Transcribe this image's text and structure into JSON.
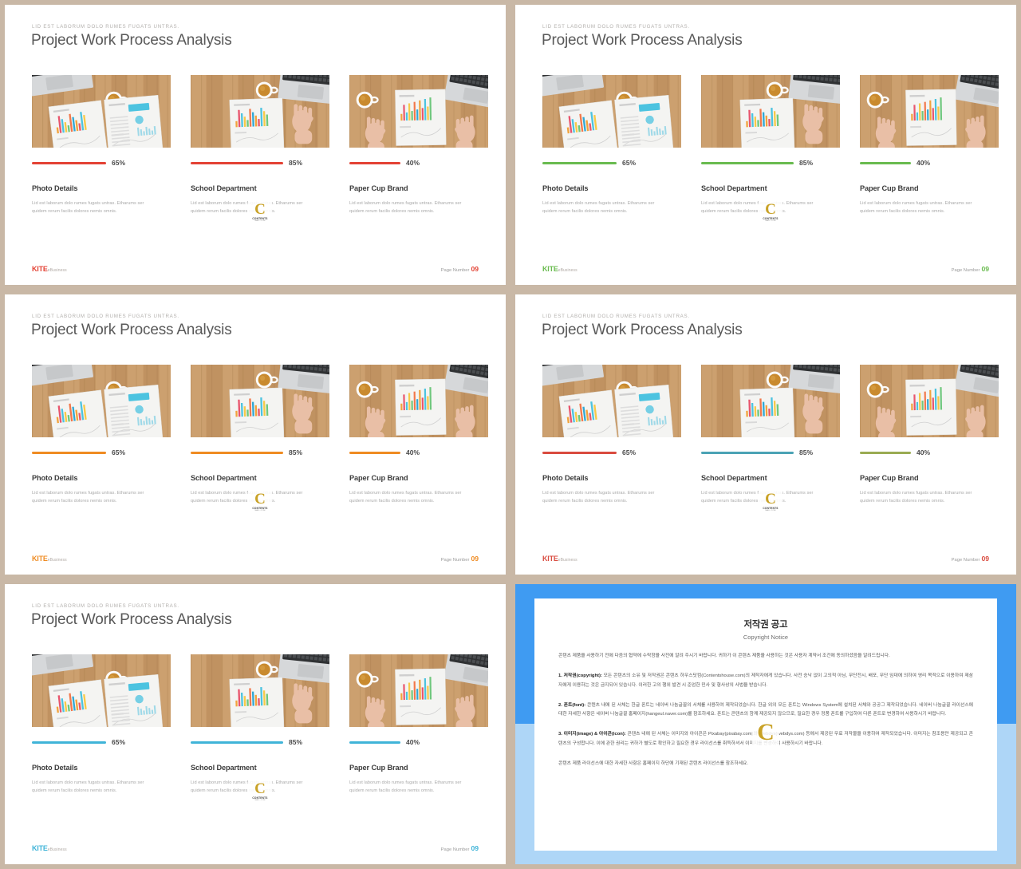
{
  "slide": {
    "eyebrow": "LID EST LABORUM  DOLO RUMES FUGATS  UNTRAS.",
    "title": "Project Work Process Analysis",
    "footer": {
      "brand_main": "KITE",
      "brand_sub": "eBusiness",
      "page_label": "Page Number",
      "page_number": "09"
    },
    "cards": [
      {
        "title": "Photo Details",
        "body": "Lid est laborum dolo rumes fugats untras. Etharums ser quidem rerum facilis dolores nemis omnis.",
        "percent_label": "65%",
        "percent_value": 65
      },
      {
        "title": "School Department",
        "body": "Lid est laborum dolo rumes fugats untras. Etharums ser quidem rerum facilis dolores nemis omnis.",
        "percent_label": "85%",
        "percent_value": 85
      },
      {
        "title": "Paper Cup Brand",
        "body": "Lid est laborum dolo rumes fugats untras. Etharums ser quidem rerum facilis dolores nemis omnis.",
        "percent_label": "40%",
        "percent_value": 40
      }
    ]
  },
  "variants": [
    {
      "name": "red",
      "accent": "#e34234",
      "bar_colors": [
        "#e34234",
        "#e34234",
        "#e34234"
      ],
      "brand_color": "#e34234",
      "page_color": "#e34234"
    },
    {
      "name": "green",
      "accent": "#69bb4f",
      "bar_colors": [
        "#69bb4f",
        "#69bb4f",
        "#69bb4f"
      ],
      "brand_color": "#69bb4f",
      "page_color": "#69bb4f"
    },
    {
      "name": "orange",
      "accent": "#ef8b22",
      "bar_colors": [
        "#ef8b22",
        "#ef8b22",
        "#ef8b22"
      ],
      "brand_color": "#ef8b22",
      "page_color": "#ef8b22"
    },
    {
      "name": "multicolor",
      "accent": "#d94b3f",
      "bar_colors": [
        "#d94b3f",
        "#4ba3b5",
        "#9aab52"
      ],
      "brand_color": "#d94b3f",
      "page_color": "#d94b3f"
    },
    {
      "name": "blue",
      "accent": "#40b4d8",
      "bar_colors": [
        "#40b4d8",
        "#40b4d8",
        "#40b4d8"
      ],
      "brand_color": "#40b4d8",
      "page_color": "#40b4d8"
    }
  ],
  "photo_watermark": {
    "letter": "C",
    "title": "CONTENTS",
    "subtitle": "MALL.COM"
  },
  "copyright": {
    "title": "저작권 공고",
    "subtitle": "Copyright Notice",
    "watermark_letter": "C",
    "intro": "콘텐츠 제품을 사용하기 전에 다음의 협약에 수락함을 사전에 알려 주시기 바랍니다. 귀하가 이 콘텐츠 제품을 사용하는 것은 사용자 계약서 조건에 동의하셨음을 알려드립니다.",
    "sections": [
      {
        "heading": "1. 저작권(copyright):",
        "text": "모든 콘텐츠의 소유 및 저작권은 콘텐츠 하우스닷컴(Contentshouse.com)의 제작자에게 있습니다. 사전 승낙 없이 고의적 아님, 무단전시, 배포, 무단 임대에 의하여 영리 목적으로 이용하여 제삼자에게 이용하는 것은 금지되어 있습니다. 이러한 고의 행위 발견 시 준엄한 민사 및 형사상의 사법을 받습니다."
      },
      {
        "heading": "2. 폰트(font):",
        "text": "콘텐츠 내에 된 서체는 한글 폰트는 네이버 나눔글꼴의 서체를 사용하여 제작되었습니다. 한글 외의 모든 폰트는 Windows System에 설치된 서체와 공공그 제작되었습니다. 네이버 나눔글꼴 라이선스에 대한 자세한 사항은 네이버 나눔글꼴 홈페이지(hangeul.naver.com)를 참조하세요. 폰트는 콘텐츠의 함께 제공되지 않으므로, 필요한 경우 정품 폰트를 구입하여 다른 폰트로 변경하여 사용하시기 바랍니다."
      },
      {
        "heading": "3. 이미지(image) & 아이콘(icon):",
        "text": "콘텐츠 내에 된 서체는 이미지와 아이콘은 Pixabay(pixabay.com)와 Webdys(webdys.com) 등에서 제공된 무료 저작물을 이용하여 제작되었습니다. 이미지는 참조용만 제공되고 콘텐츠의 구성합니다. 이에 관한 권리는 귀하가 별도로 확인하고 필요한 경우 라이선스를 취득하셔서 이미지를 변경하여 사용하시기 바랍니다."
      }
    ],
    "closing": "콘텐츠 제품 라이선스에 대한 자세한 사항은 홈페이지 하단에 기재된 콘텐츠 라이선스를 참조하세요."
  }
}
